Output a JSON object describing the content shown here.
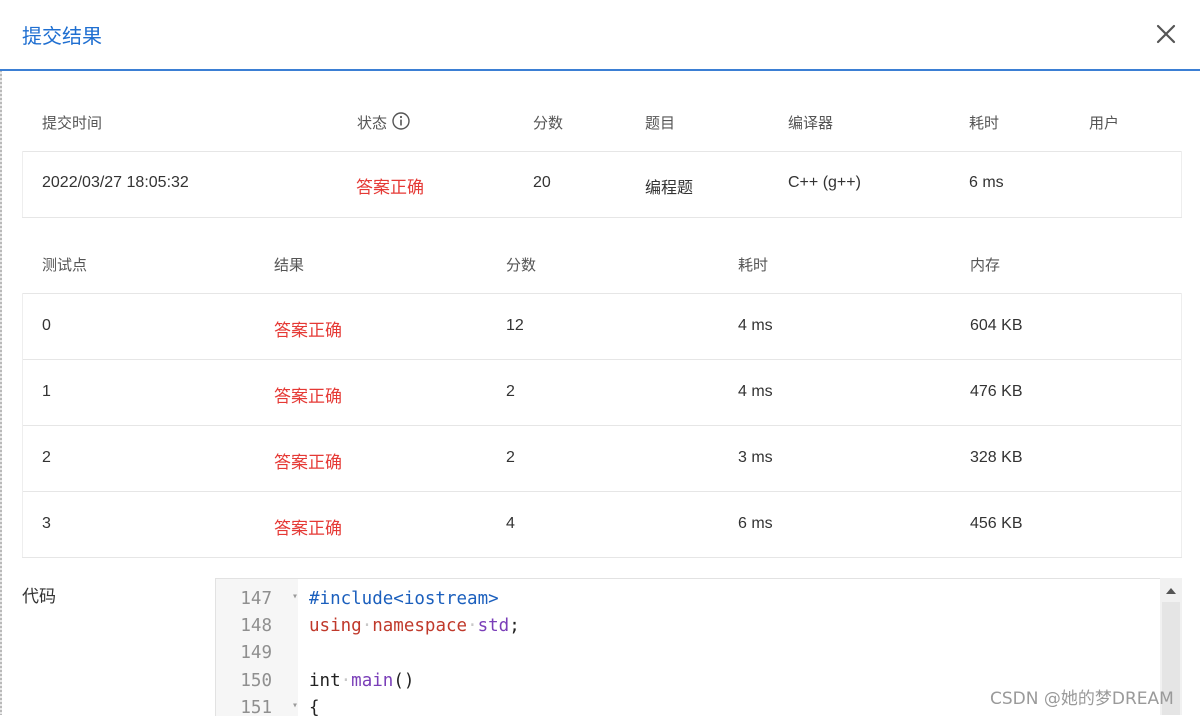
{
  "dialog": {
    "title": "提交结果",
    "close_label": "close"
  },
  "submission": {
    "headers": [
      "提交时间",
      "状态",
      "分数",
      "题目",
      "编译器",
      "耗时",
      "用户"
    ],
    "row": {
      "time": "2022/03/27 18:05:32",
      "status": "答案正确",
      "score": "20",
      "problem": "编程题",
      "compiler": "C++ (g++)",
      "elapsed": "6 ms",
      "user": ""
    }
  },
  "testcases": {
    "headers": [
      "测试点",
      "结果",
      "分数",
      "耗时",
      "内存"
    ],
    "rows": [
      {
        "id": "0",
        "result": "答案正确",
        "score": "12",
        "time": "4 ms",
        "memory": "604 KB"
      },
      {
        "id": "1",
        "result": "答案正确",
        "score": "2",
        "time": "4 ms",
        "memory": "476 KB"
      },
      {
        "id": "2",
        "result": "答案正确",
        "score": "2",
        "time": "3 ms",
        "memory": "328 KB"
      },
      {
        "id": "3",
        "result": "答案正确",
        "score": "4",
        "time": "6 ms",
        "memory": "456 KB"
      }
    ]
  },
  "code": {
    "label": "代码",
    "lines": [
      {
        "num": "147",
        "fold": "▾"
      },
      {
        "num": "148",
        "fold": ""
      },
      {
        "num": "149",
        "fold": ""
      },
      {
        "num": "150",
        "fold": ""
      },
      {
        "num": "151",
        "fold": "▾"
      }
    ],
    "tokens": {
      "include": "#include<iostream>",
      "using": "using",
      "namespace": "namespace",
      "std": "std",
      "semicolon": ";",
      "int": "int",
      "main": "main",
      "parens": "()",
      "brace": "{",
      "space_dot": "·"
    }
  },
  "watermark": "CSDN @她的梦DREAM",
  "colors": {
    "accent": "#1f6fd1",
    "success_red": "#e53935"
  },
  "icons": [
    "close-icon",
    "info-icon",
    "chevron-up-icon"
  ]
}
